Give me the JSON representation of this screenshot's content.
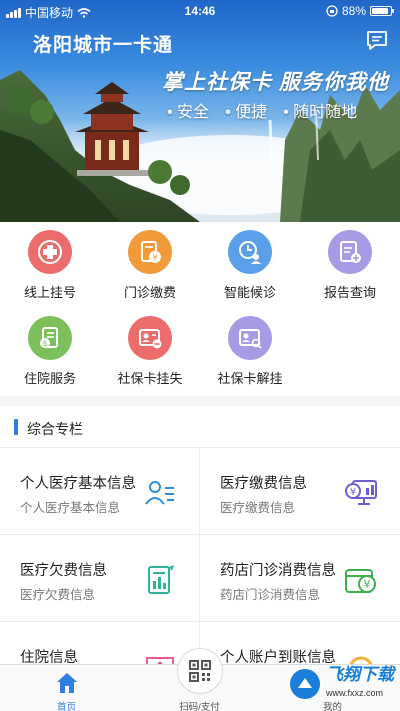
{
  "status_bar": {
    "carrier": "中国移动",
    "time": "14:46",
    "battery": "88%",
    "battery_level": 0.88
  },
  "header": {
    "title": "洛阳城市一卡通",
    "message_icon": "message-icon"
  },
  "banner": {
    "slogan": "掌上社保卡 服务你我他",
    "features": [
      "安全",
      "便捷",
      "随时随地"
    ]
  },
  "services": [
    {
      "label": "线上挂号",
      "icon": "hospital-cross-icon",
      "color": "#ec6b6b"
    },
    {
      "label": "门诊缴费",
      "icon": "bill-yen-icon",
      "color": "#f09a3a"
    },
    {
      "label": "智能候诊",
      "icon": "clock-user-icon",
      "color": "#5aa0e8"
    },
    {
      "label": "报告查询",
      "icon": "report-add-icon",
      "color": "#a79be6"
    },
    {
      "label": "住院服务",
      "icon": "inpatient-money-icon",
      "color": "#7bc05a"
    },
    {
      "label": "社保卡挂失",
      "icon": "card-minus-icon",
      "color": "#ec6b6b"
    },
    {
      "label": "社保卡解挂",
      "icon": "card-search-icon",
      "color": "#a79be6"
    }
  ],
  "section": {
    "title": "综合专栏"
  },
  "cards": [
    {
      "title": "个人医疗基本信息",
      "subtitle": "个人医疗基本信息",
      "icon": "user-list-icon",
      "color": "#2e8fd8"
    },
    {
      "title": "医疗缴费信息",
      "subtitle": "医疗缴费信息",
      "icon": "monitor-payment-icon",
      "color": "#6a5fd0"
    },
    {
      "title": "医疗欠费信息",
      "subtitle": "医疗欠费信息",
      "icon": "document-chart-icon",
      "color": "#2bb59a"
    },
    {
      "title": "药店门诊消费信息",
      "subtitle": "药店门诊消费信息",
      "icon": "wallet-yen-icon",
      "color": "#3fae4f"
    },
    {
      "title": "住院信息",
      "subtitle": "",
      "icon": "hospital-building-icon",
      "color": "#e85c8a"
    },
    {
      "title": "个人账户到账信息",
      "subtitle": "",
      "icon": "coin-icon",
      "color": "#f2b23a"
    }
  ],
  "tabbar": {
    "tabs": [
      {
        "label": "首页",
        "icon": "home-icon"
      },
      {
        "label": "扫码/支付",
        "icon": "qr-code-icon"
      },
      {
        "label": "我的",
        "icon": "user-icon"
      }
    ]
  },
  "watermark": {
    "text": "飞翔下载",
    "url": "www.fxxz.com"
  }
}
